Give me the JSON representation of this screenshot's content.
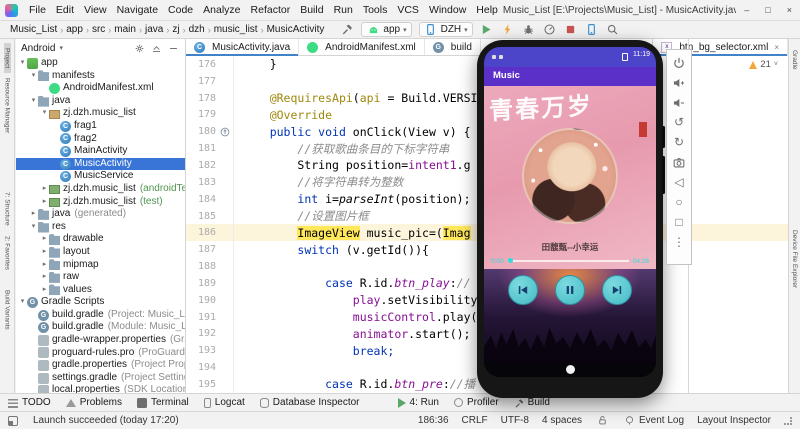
{
  "window": {
    "title": "Music_List [E:\\Projects\\Music_List] - MusicActivity.java [Music_List.app]",
    "menus": [
      "File",
      "Edit",
      "View",
      "Navigate",
      "Code",
      "Analyze",
      "Refactor",
      "Build",
      "Run",
      "Tools",
      "VCS",
      "Window",
      "Help"
    ],
    "controls": {
      "minimize": "–",
      "maximize": "□",
      "close": "×"
    }
  },
  "breadcrumbs": [
    "Music_List",
    "app",
    "src",
    "main",
    "java",
    "zj",
    "dzh",
    "music_list",
    "MusicActivity"
  ],
  "run_toolbar": {
    "config": "app",
    "device": "DZH",
    "caret": "▾"
  },
  "left_stripe": [
    {
      "label": "Project",
      "active": true
    },
    {
      "label": "Resource Manager"
    },
    {
      "label": "7: Structure"
    },
    {
      "label": "2: Favorites"
    },
    {
      "label": "Build Variants"
    }
  ],
  "right_stripe": [
    "Gradle",
    "Device File Explorer"
  ],
  "project": {
    "header": "Android",
    "header_caret": "▾",
    "tree": [
      {
        "l": 0,
        "arrow": "open",
        "icon": "module",
        "label": "app"
      },
      {
        "l": 1,
        "arrow": "open",
        "icon": "folder",
        "label": "manifests"
      },
      {
        "l": 2,
        "icon": "android",
        "label": "AndroidManifest.xml"
      },
      {
        "l": 1,
        "arrow": "open",
        "icon": "folder",
        "label": "java"
      },
      {
        "l": 2,
        "arrow": "open",
        "icon": "package",
        "label": "zj.dzh.music_list"
      },
      {
        "l": 3,
        "icon": "class",
        "label": "frag1"
      },
      {
        "l": 3,
        "icon": "class",
        "label": "frag2"
      },
      {
        "l": 3,
        "icon": "class",
        "label": "MainActivity"
      },
      {
        "l": 3,
        "icon": "class",
        "label": "MusicActivity",
        "sel": true
      },
      {
        "l": 3,
        "icon": "class",
        "label": "MusicService"
      },
      {
        "l": 2,
        "arrow": "closed",
        "icon": "package-green",
        "label": "zj.dzh.music_list",
        "sec": "(androidTest)",
        "secGreen": true
      },
      {
        "l": 2,
        "arrow": "closed",
        "icon": "package-green",
        "label": "zj.dzh.music_list",
        "sec": "(test)",
        "secGreen": true
      },
      {
        "l": 1,
        "arrow": "closed",
        "icon": "folder",
        "label": "java",
        "sec": "(generated)"
      },
      {
        "l": 1,
        "arrow": "open",
        "icon": "folder",
        "label": "res"
      },
      {
        "l": 2,
        "arrow": "closed",
        "icon": "folder",
        "label": "drawable"
      },
      {
        "l": 2,
        "arrow": "closed",
        "icon": "folder",
        "label": "layout"
      },
      {
        "l": 2,
        "arrow": "closed",
        "icon": "folder",
        "label": "mipmap"
      },
      {
        "l": 2,
        "arrow": "closed",
        "icon": "folder",
        "label": "raw"
      },
      {
        "l": 2,
        "arrow": "closed",
        "icon": "folder",
        "label": "values"
      },
      {
        "l": 0,
        "arrow": "open",
        "icon": "gradle",
        "label": "Gradle Scripts"
      },
      {
        "l": 1,
        "icon": "gradle",
        "label": "build.gradle",
        "sec": "(Project: Music_List)"
      },
      {
        "l": 1,
        "icon": "gradle",
        "label": "build.gradle",
        "sec": "(Module: Music_List.app)"
      },
      {
        "l": 1,
        "icon": "props",
        "label": "gradle-wrapper.properties",
        "sec": "(Gradle Version)"
      },
      {
        "l": 1,
        "icon": "props",
        "label": "proguard-rules.pro",
        "sec": "(ProGuard Rules for M"
      },
      {
        "l": 1,
        "icon": "props",
        "label": "gradle.properties",
        "sec": "(Project Properties)"
      },
      {
        "l": 1,
        "icon": "props",
        "label": "settings.gradle",
        "sec": "(Project Settings)"
      },
      {
        "l": 1,
        "icon": "props",
        "label": "local.properties",
        "sec": "(SDK Location)"
      }
    ]
  },
  "tabs": [
    {
      "label": "MusicActivity.java",
      "icon": "class",
      "selected": true
    },
    {
      "label": "AndroidManifest.xml",
      "icon": "android"
    },
    {
      "label": "build",
      "icon": "gradle"
    }
  ],
  "right_tab": {
    "label": "btn_bg_selector.xml",
    "icon": "xml",
    "close": "×"
  },
  "inspections": {
    "warnings": "21",
    "caret": "˅"
  },
  "editor_lines": [
    {
      "n": 176,
      "t": [
        [
          "p",
          "    }"
        ]
      ]
    },
    {
      "n": 177,
      "t": []
    },
    {
      "n": 178,
      "t": [
        [
          "p",
          "    "
        ],
        [
          "a",
          "@RequiresApi"
        ],
        [
          "p",
          "("
        ],
        [
          "a",
          "api"
        ],
        [
          "p",
          " = Build.VERSI"
        ]
      ]
    },
    {
      "n": 179,
      "t": [
        [
          "p",
          "    "
        ],
        [
          "a",
          "@Override"
        ]
      ]
    },
    {
      "n": 180,
      "g": "override",
      "t": [
        [
          "p",
          "    "
        ],
        [
          "k",
          "public void "
        ],
        [
          "p",
          "onClick(View v) {"
        ]
      ]
    },
    {
      "n": 181,
      "t": [
        [
          "p",
          "        "
        ],
        [
          "c",
          "//获取歌曲条目的下标字符串"
        ]
      ]
    },
    {
      "n": 182,
      "t": [
        [
          "p",
          "        String position="
        ],
        [
          "f",
          "intent1"
        ],
        [
          "p",
          ".g"
        ]
      ]
    },
    {
      "n": 183,
      "t": [
        [
          "p",
          "        "
        ],
        [
          "c",
          "//将字符串转为整数"
        ]
      ]
    },
    {
      "n": 184,
      "t": [
        [
          "p",
          "        "
        ],
        [
          "k",
          "int "
        ],
        [
          "p",
          "i="
        ],
        [
          "sm",
          "parseInt"
        ],
        [
          "p",
          "(position);"
        ]
      ]
    },
    {
      "n": 185,
      "t": [
        [
          "p",
          "        "
        ],
        [
          "c",
          "//设置图片框"
        ]
      ]
    },
    {
      "n": 186,
      "cur": true,
      "t": [
        [
          "p",
          "        "
        ],
        [
          "hl",
          "ImageView"
        ],
        [
          "p",
          " music_pic=("
        ],
        [
          "hl",
          "Imag"
        ]
      ]
    },
    {
      "n": 187,
      "t": [
        [
          "p",
          "        "
        ],
        [
          "k",
          "switch "
        ],
        [
          "p",
          "(v.getId()){"
        ]
      ]
    },
    {
      "n": 188,
      "t": []
    },
    {
      "n": 189,
      "t": [
        [
          "p",
          "            "
        ],
        [
          "k",
          "case "
        ],
        [
          "p",
          "R.id."
        ],
        [
          "sf",
          "btn_play"
        ],
        [
          "p",
          ":"
        ],
        [
          "c",
          "//"
        ]
      ]
    },
    {
      "n": 190,
      "t": [
        [
          "p",
          "                "
        ],
        [
          "f",
          "play"
        ],
        [
          "p",
          ".setVisibility"
        ]
      ]
    },
    {
      "n": 191,
      "t": [
        [
          "p",
          "                "
        ],
        [
          "f",
          "musicControl"
        ],
        [
          "p",
          ".play("
        ]
      ]
    },
    {
      "n": 192,
      "t": [
        [
          "p",
          "                "
        ],
        [
          "f",
          "animator"
        ],
        [
          "p",
          ".start();"
        ]
      ]
    },
    {
      "n": 193,
      "t": [
        [
          "p",
          "                "
        ],
        [
          "k",
          "break;"
        ]
      ]
    },
    {
      "n": 194,
      "t": []
    },
    {
      "n": 195,
      "t": [
        [
          "p",
          "            "
        ],
        [
          "k",
          "case "
        ],
        [
          "p",
          "R.id."
        ],
        [
          "sf",
          "btn_pre"
        ],
        [
          "p",
          ":"
        ],
        [
          "c",
          "//播"
        ]
      ]
    }
  ],
  "phone": {
    "status_time": "11:19",
    "app_title": "Music",
    "album_caption": "青春万岁",
    "song": "田馥甄--小幸运",
    "elapsed": "0:00",
    "duration": "04:26"
  },
  "emulator_toolbar": [
    "power",
    "volume-up",
    "volume-down",
    "rotate-left",
    "rotate-right",
    "screenshot",
    "back",
    "home",
    "overview",
    "more"
  ],
  "bottom_bar": {
    "left": [
      {
        "icon": "todo",
        "label": "TODO"
      },
      {
        "icon": "problems",
        "label": "Problems"
      },
      {
        "icon": "terminal",
        "label": "Terminal"
      },
      {
        "icon": "logcat",
        "label": "Logcat"
      },
      {
        "icon": "database",
        "label": "Database Inspector"
      }
    ],
    "right": [
      {
        "icon": "run",
        "label": "4: Run"
      },
      {
        "icon": "profiler",
        "label": "Profiler"
      },
      {
        "icon": "build",
        "label": "Build"
      }
    ]
  },
  "status_bar": {
    "message": "Launch succeeded (today 17:20)",
    "caret": "186:36",
    "line_sep": "CRLF",
    "encoding": "UTF-8",
    "indent": "4 spaces",
    "event_log": "Event Log",
    "layout_inspector": "Layout Inspector"
  },
  "colors": {
    "accent": "#4083C9",
    "selection": "#3875D6",
    "run_green": "#59A869",
    "stop_red": "#C75450",
    "warning": "#F2A63B",
    "player_teal": "#46BAC4",
    "app_purple": "#5A30C8"
  }
}
